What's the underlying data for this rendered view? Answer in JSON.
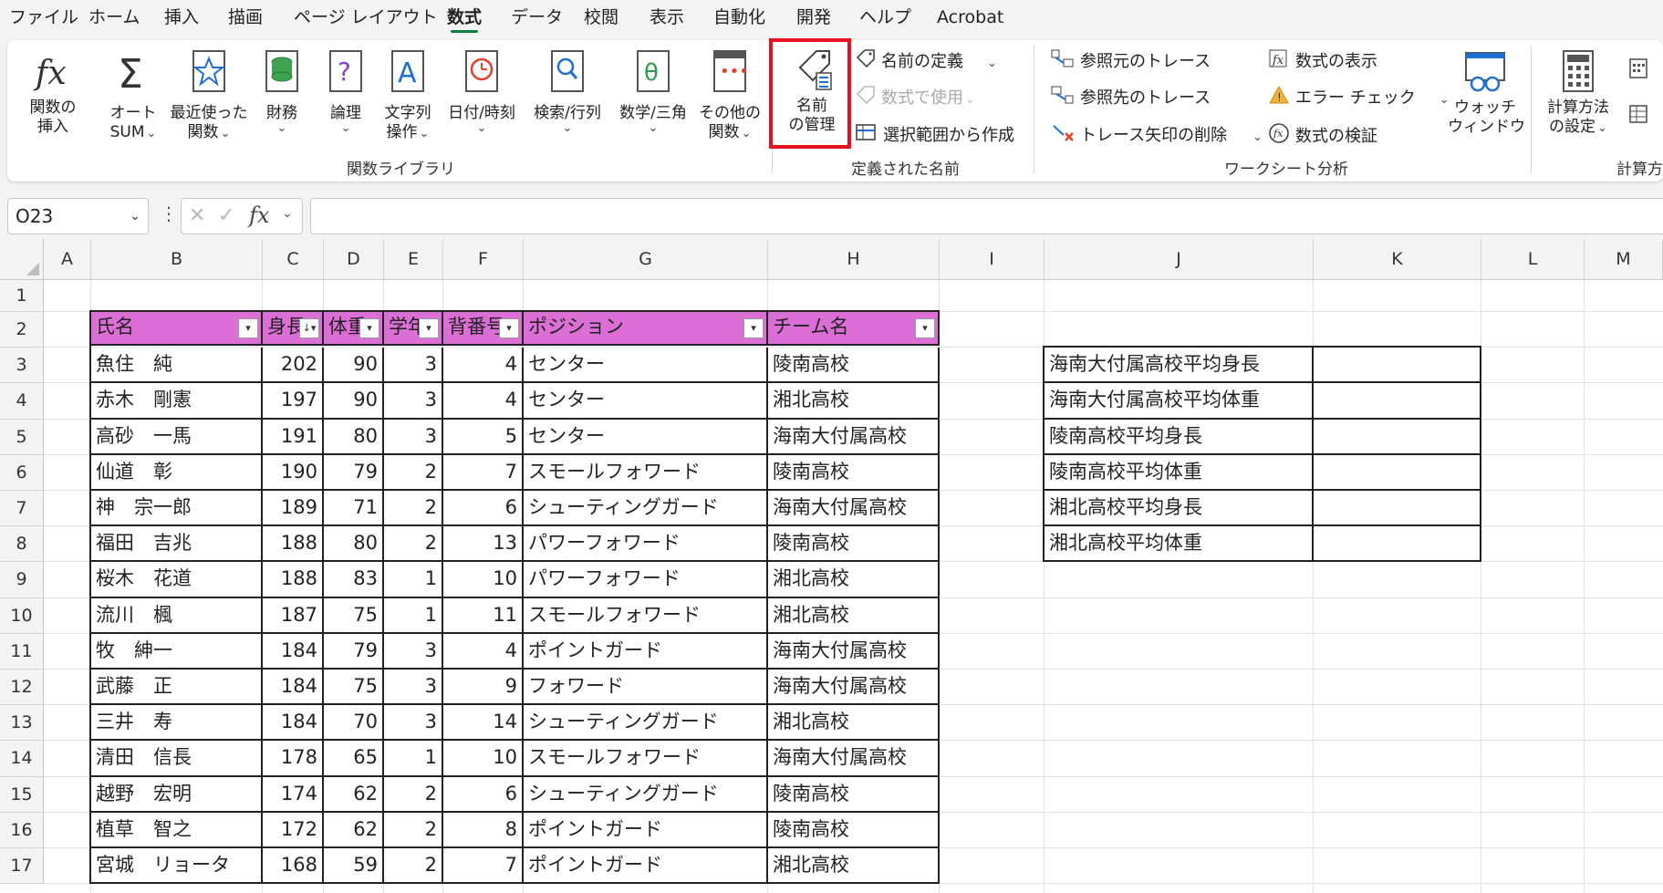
{
  "menu": {
    "tabs": [
      "ファイル",
      "ホーム",
      "挿入",
      "描画",
      "ページ レイアウト",
      "数式",
      "データ",
      "校閲",
      "表示",
      "自動化",
      "開発",
      "ヘルプ",
      "Acrobat"
    ],
    "active": "数式"
  },
  "ribbon": {
    "function_library": {
      "label": "関数ライブラリ",
      "insert_function": [
        "関数の",
        "挿入"
      ],
      "autosum": [
        "オート",
        "SUM"
      ],
      "recent": [
        "最近使った",
        "関数"
      ],
      "financial": "財務",
      "logical": "論理",
      "text": [
        "文字列",
        "操作"
      ],
      "datetime": "日付/時刻",
      "lookup": "検索/行列",
      "math": "数学/三角",
      "more": [
        "その他の",
        "関数"
      ]
    },
    "defined_names": {
      "label": "定義された名前",
      "name_manager": [
        "名前",
        "の管理"
      ],
      "define_name": "名前の定義",
      "use_in_formula": "数式で使用",
      "create_from_selection": "選択範囲から作成"
    },
    "formula_auditing": {
      "label": "ワークシート分析",
      "trace_precedents": "参照元のトレース",
      "trace_dependents": "参照先のトレース",
      "remove_arrows": "トレース矢印の削除",
      "show_formulas": "数式の表示",
      "error_checking": "エラー チェック",
      "evaluate_formula": "数式の検証",
      "watch_window": [
        "ウォッチ",
        "ウィンドウ"
      ]
    },
    "calculation": {
      "label": "計算方",
      "options": [
        "計算方法",
        "の設定"
      ]
    },
    "colors": {
      "highlight": "#e8121e",
      "accent": "#107c41",
      "header_fill": "#dc6fd6"
    }
  },
  "formula_bar": {
    "name_box": "O23",
    "fx": "fx",
    "formula": ""
  },
  "grid": {
    "columns": [
      "A",
      "B",
      "C",
      "D",
      "E",
      "F",
      "G",
      "H",
      "I",
      "J",
      "K",
      "L",
      "M"
    ],
    "rows": [
      "1",
      "2",
      "3",
      "4",
      "5",
      "6",
      "7",
      "8",
      "9",
      "10",
      "11",
      "12",
      "13",
      "14",
      "15",
      "16",
      "17"
    ],
    "table_headers": [
      "氏名",
      "身長",
      "体重",
      "学年",
      "背番号",
      "ポジション",
      "チーム名"
    ],
    "table_rows": [
      [
        "魚住　純",
        "202",
        "90",
        "3",
        "4",
        "センター",
        "陵南高校"
      ],
      [
        "赤木　剛憲",
        "197",
        "90",
        "3",
        "4",
        "センター",
        "湘北高校"
      ],
      [
        "高砂　一馬",
        "191",
        "80",
        "3",
        "5",
        "センター",
        "海南大付属高校"
      ],
      [
        "仙道　彰",
        "190",
        "79",
        "2",
        "7",
        "スモールフォワード",
        "陵南高校"
      ],
      [
        "神　宗一郎",
        "189",
        "71",
        "2",
        "6",
        "シューティングガード",
        "海南大付属高校"
      ],
      [
        "福田　吉兆",
        "188",
        "80",
        "2",
        "13",
        "パワーフォワード",
        "陵南高校"
      ],
      [
        "桜木　花道",
        "188",
        "83",
        "1",
        "10",
        "パワーフォワード",
        "湘北高校"
      ],
      [
        "流川　楓",
        "187",
        "75",
        "1",
        "11",
        "スモールフォワード",
        "湘北高校"
      ],
      [
        "牧　紳一",
        "184",
        "79",
        "3",
        "4",
        "ポイントガード",
        "海南大付属高校"
      ],
      [
        "武藤　正",
        "184",
        "75",
        "3",
        "9",
        "フォワード",
        "海南大付属高校"
      ],
      [
        "三井　寿",
        "184",
        "70",
        "3",
        "14",
        "シューティングガード",
        "湘北高校"
      ],
      [
        "清田　信長",
        "178",
        "65",
        "1",
        "10",
        "スモールフォワード",
        "海南大付属高校"
      ],
      [
        "越野　宏明",
        "174",
        "62",
        "2",
        "6",
        "シューティングガード",
        "陵南高校"
      ],
      [
        "植草　智之",
        "172",
        "62",
        "2",
        "8",
        "ポイントガード",
        "陵南高校"
      ],
      [
        "宮城　リョータ",
        "168",
        "59",
        "2",
        "7",
        "ポイントガード",
        "湘北高校"
      ]
    ],
    "summary_labels": [
      "海南大付属高校平均身長",
      "海南大付属高校平均体重",
      "陵南高校平均身長",
      "陵南高校平均体重",
      "湘北高校平均身長",
      "湘北高校平均体重"
    ]
  }
}
